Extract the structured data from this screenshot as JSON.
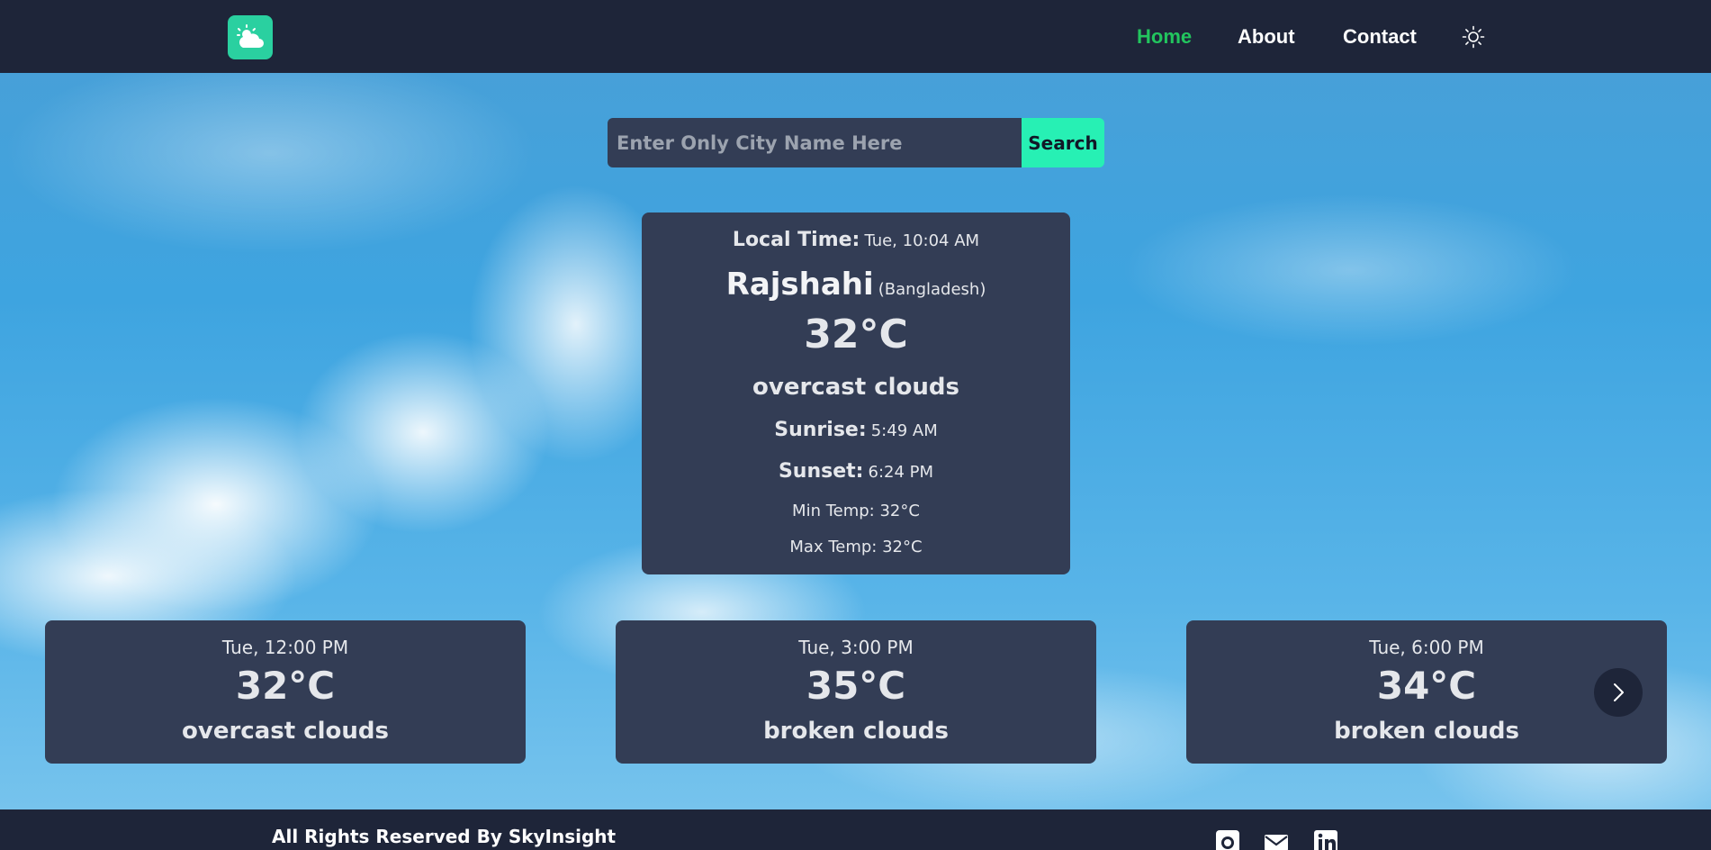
{
  "header": {
    "nav": {
      "home": "Home",
      "about": "About",
      "contact": "Contact"
    },
    "icons": {
      "logo": "cloud-sun-icon",
      "theme_toggle": "sun-icon"
    },
    "colors": {
      "background": "#1e2539",
      "active_link": "#22c55e",
      "logo_bg": "#2ad0a0"
    }
  },
  "search": {
    "placeholder": "Enter Only City Name Here",
    "value": "",
    "button_label": "Search",
    "button_color": "#27f0b4"
  },
  "current": {
    "local_time_label": "Local Time:",
    "local_time_value": "Tue, 10:04 AM",
    "city": "Rajshahi",
    "country": "(Bangladesh)",
    "temperature": "32°C",
    "description": "overcast clouds",
    "sunrise_label": "Sunrise:",
    "sunrise_value": "5:49 AM",
    "sunset_label": "Sunset:",
    "sunset_value": "6:24 PM",
    "min_temp": "Min Temp: 32°C",
    "max_temp": "Max Temp: 32°C"
  },
  "forecast": [
    {
      "time": "Tue, 12:00 PM",
      "temp": "32°C",
      "desc": "overcast clouds"
    },
    {
      "time": "Tue, 3:00 PM",
      "temp": "35°C",
      "desc": "broken clouds"
    },
    {
      "time": "Tue, 6:00 PM",
      "temp": "34°C",
      "desc": "broken clouds"
    }
  ],
  "carousel": {
    "next_icon": "chevron-right-icon"
  },
  "footer": {
    "text": "All Rights Reserved By SkyInsight",
    "icons": [
      "github-icon",
      "mail-icon",
      "linkedin-icon"
    ]
  }
}
